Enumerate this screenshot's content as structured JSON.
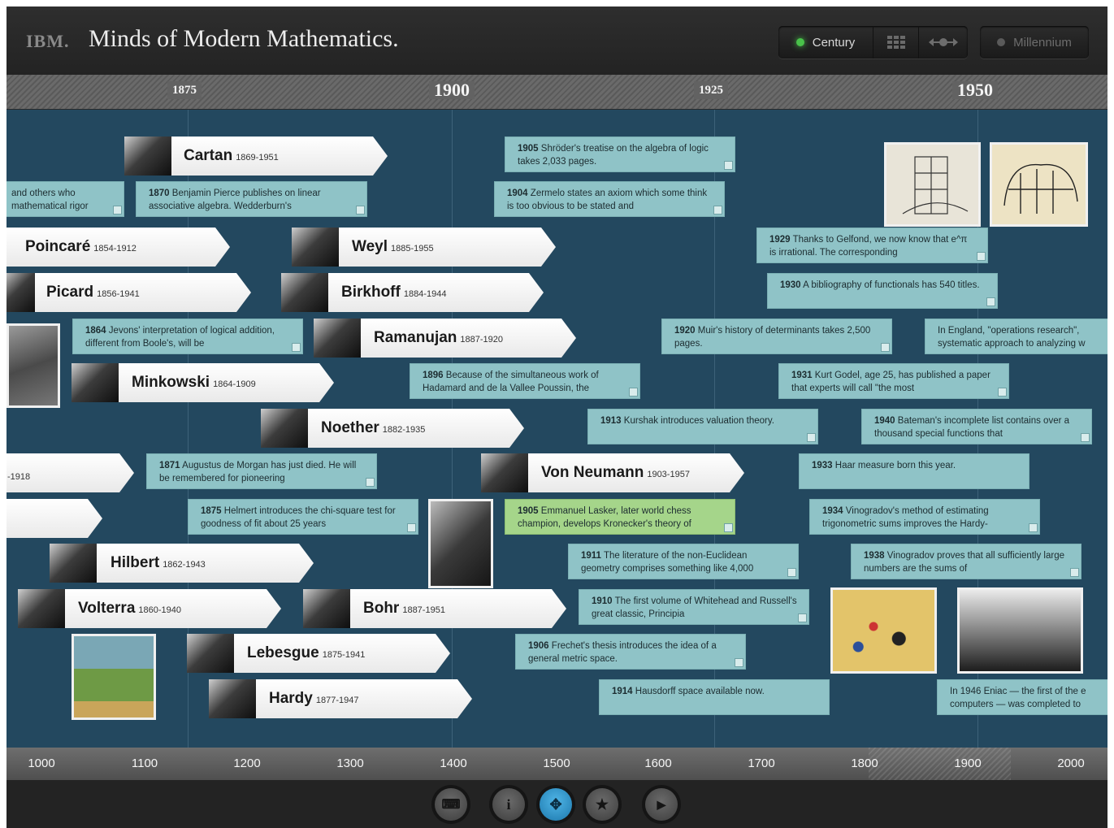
{
  "header": {
    "logo": "IBM.",
    "title": "Minds of Modern Mathematics.",
    "scale_century": "Century",
    "scale_millennium": "Millennium",
    "active_scale": "Century",
    "active_color": "#49c24a",
    "inactive_color": "#5a5a5a"
  },
  "ruler": {
    "years": [
      "1875",
      "1900",
      "1925",
      "1950"
    ]
  },
  "mathematicians": [
    {
      "name": "Cartan",
      "years": "1869-1951"
    },
    {
      "name": "Poincaré",
      "years": "1854-1912"
    },
    {
      "name": "Weyl",
      "years": "1885-1955"
    },
    {
      "name": "Picard",
      "years": "1856-1941"
    },
    {
      "name": "Birkhoff",
      "years": "1884-1944"
    },
    {
      "name": "Ramanujan",
      "years": "1887-1920"
    },
    {
      "name": "Minkowski",
      "years": "1864-1909"
    },
    {
      "name": "Noether",
      "years": "1882-1935"
    },
    {
      "name": "",
      "years": "-1918"
    },
    {
      "name": "Von Neumann",
      "years": "1903-1957"
    },
    {
      "name": "",
      "years": ""
    },
    {
      "name": "Hilbert",
      "years": "1862-1943"
    },
    {
      "name": "Volterra",
      "years": "1860-1940"
    },
    {
      "name": "Bohr",
      "years": "1887-1951"
    },
    {
      "name": "Lebesgue",
      "years": "1875-1941"
    },
    {
      "name": "Hardy",
      "years": "1877-1947"
    }
  ],
  "events": [
    {
      "year": "",
      "text": "and others who mathematical rigor"
    },
    {
      "year": "1870",
      "text": "Benjamin Pierce publishes on linear associative algebra. Wedderburn's"
    },
    {
      "year": "1905",
      "text": "Shröder's treatise on the algebra of logic takes 2,033 pages."
    },
    {
      "year": "1904",
      "text": "Zermelo states an axiom which some think is too obvious to be stated and"
    },
    {
      "year": "1929",
      "text": "Thanks to Gelfond, we now know that e^π is irrational. The corresponding"
    },
    {
      "year": "1930",
      "text": "A bibliography of functionals has 540 titles."
    },
    {
      "year": "1864",
      "text": "Jevons' interpretation of logical addition, different from Boole's, will be"
    },
    {
      "year": "1920",
      "text": "Muir's history of determinants takes 2,500 pages."
    },
    {
      "year": "",
      "text": "In England, \"operations research\", systematic approach to analyzing w"
    },
    {
      "year": "1896",
      "text": "Because of the simultaneous work of Hadamard and de la Vallee Poussin, the"
    },
    {
      "year": "1931",
      "text": "Kurt Godel, age 25, has published a paper that experts will call \"the most"
    },
    {
      "year": "1913",
      "text": "Kurshak introduces valuation theory."
    },
    {
      "year": "1940",
      "text": "Bateman's incomplete list contains over a thousand special functions that"
    },
    {
      "year": "1871",
      "text": "Augustus de Morgan has just died. He will be remembered for pioneering"
    },
    {
      "year": "1933",
      "text": "Haar measure born this year."
    },
    {
      "year": "1875",
      "text": "Helmert introduces the chi-square test for goodness of fit about 25 years"
    },
    {
      "year": "1905",
      "text": "Emmanuel Lasker, later world chess champion, develops Kronecker's theory of"
    },
    {
      "year": "1934",
      "text": "Vinogradov's method of estimating trigonometric sums improves the Hardy-"
    },
    {
      "year": "1911",
      "text": "The literature of the non-Euclidean geometry comprises something like 4,000"
    },
    {
      "year": "1938",
      "text": "Vinogradov proves that all sufficiently large numbers are the sums of"
    },
    {
      "year": "1910",
      "text": "The first volume of Whitehead and Russell's great classic, Principia"
    },
    {
      "year": "1906",
      "text": "Frechet's thesis introduces the idea of a general metric space."
    },
    {
      "year": "1914",
      "text": "Hausdorff space available now."
    },
    {
      "year": "",
      "text": "In 1946 Eniac — the first of the e computers — was completed to"
    }
  ],
  "axis": {
    "labels": [
      "1000",
      "1100",
      "1200",
      "1300",
      "1400",
      "1500",
      "1600",
      "1700",
      "1800",
      "1900",
      "2000"
    ]
  },
  "toolbar": {
    "buttons": [
      {
        "name": "keyboard",
        "symbol": "⌨"
      },
      {
        "name": "info",
        "symbol": "i"
      },
      {
        "name": "navigate",
        "symbol": "✥"
      },
      {
        "name": "favorites",
        "symbol": "★"
      },
      {
        "name": "play",
        "symbol": "▶"
      }
    ],
    "active": "navigate"
  },
  "colors": {
    "background": "#23485f",
    "event_card": "#8fc3c7",
    "event_highlight": "#a5d58a",
    "accent": "#2a8cc4"
  }
}
